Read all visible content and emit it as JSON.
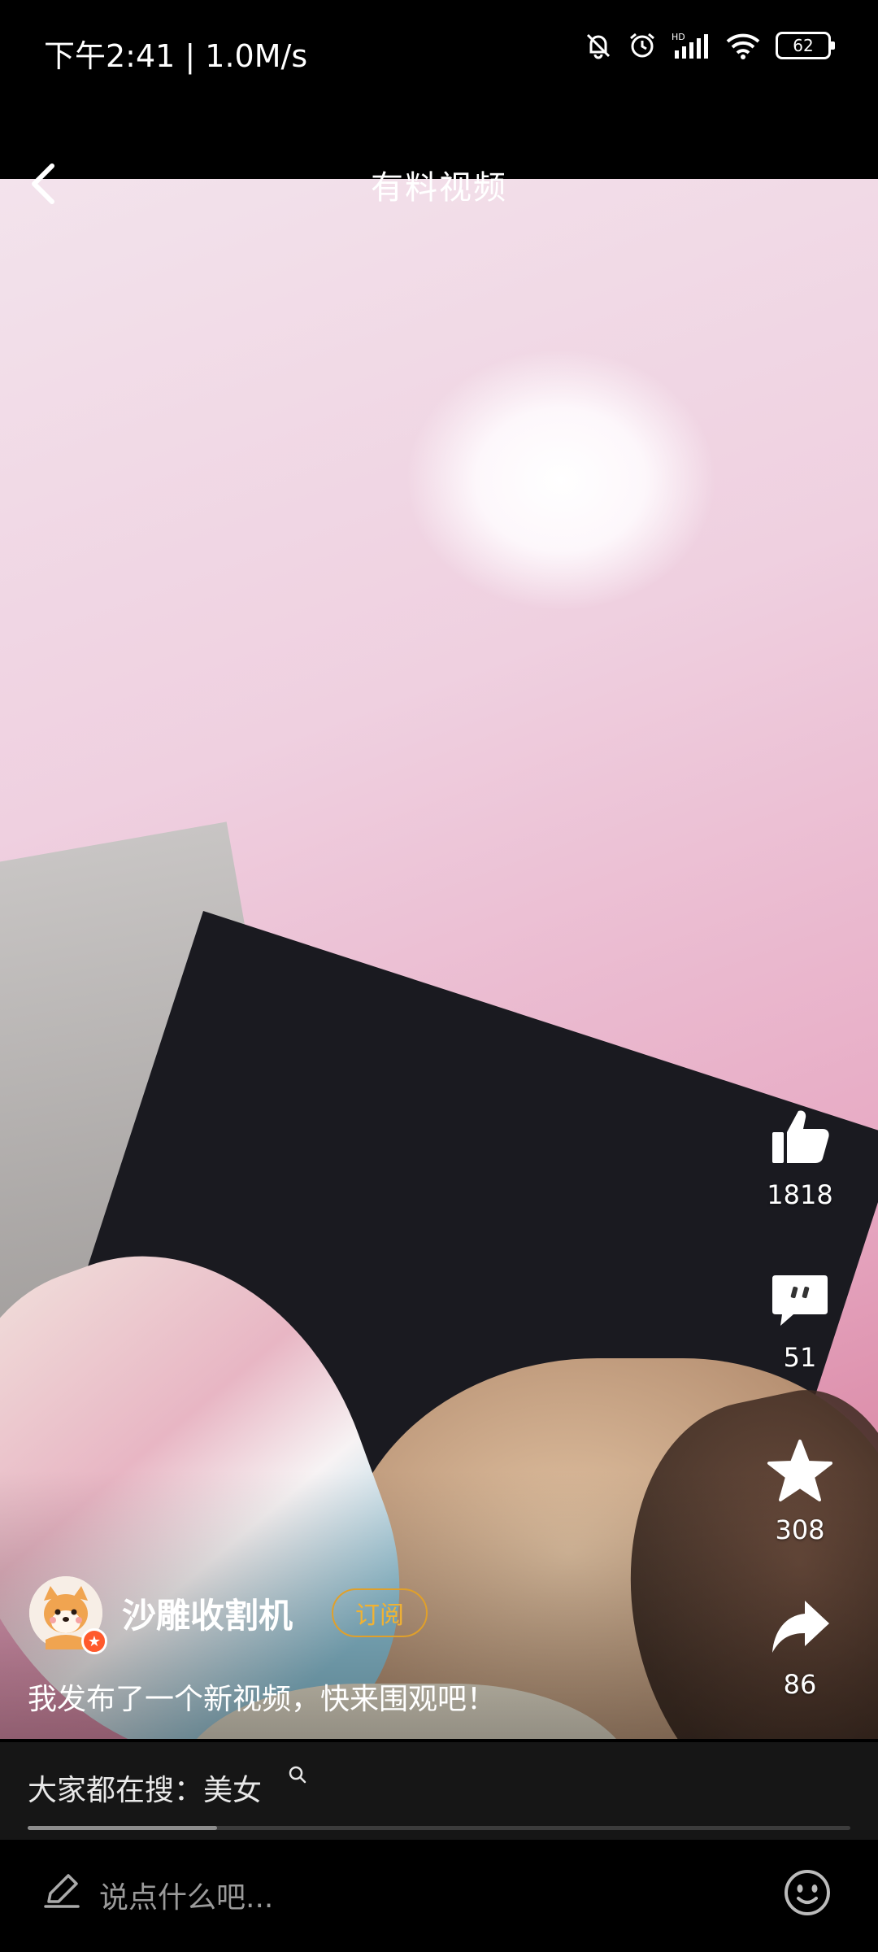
{
  "status_bar": {
    "time": "下午2:41 | 1.0M/s",
    "battery": "62"
  },
  "header": {
    "title": "有料视频",
    "back_icon": "chevron-left-icon"
  },
  "actions": {
    "like": {
      "icon": "thumbs-up-icon",
      "count": "1818"
    },
    "comment": {
      "icon": "comment-bubble-icon",
      "count": "51"
    },
    "favorite": {
      "icon": "star-icon",
      "count": "308"
    },
    "share": {
      "icon": "share-arrow-icon",
      "count": "86"
    }
  },
  "author": {
    "name": "沙雕收割机",
    "subscribe_label": "订阅"
  },
  "description": "我发布了一个新视频，快来围观吧！",
  "search_hint": {
    "text": "大家都在搜：美女",
    "icon": "search-icon"
  },
  "video_progress": 0.23,
  "comment_bar": {
    "placeholder": "说点什么吧...",
    "pencil_icon": "pencil-icon",
    "emoji_icon": "emoji-icon"
  },
  "colors": {
    "subscribe_accent": "#f1b232",
    "background": "#000000"
  }
}
